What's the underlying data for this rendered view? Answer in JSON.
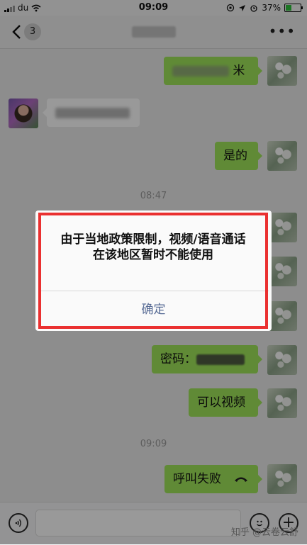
{
  "status_bar": {
    "carrier": "du",
    "time": "09:09",
    "battery_percent": "37%"
  },
  "navbar": {
    "unread_count": "3"
  },
  "messages": {
    "m1_suffix": "米",
    "m3_text": "是的",
    "time_1": "08:47",
    "m7_prefix": "密码：",
    "m8_text": "可以视频",
    "time_2": "09:09",
    "m9_text": "呼叫失败"
  },
  "dialog": {
    "message_line1": "由于当地政策限制，视频/语音通话",
    "message_line2": "在该地区暂时不能使用",
    "confirm_label": "确定"
  },
  "watermark": "知乎 @云卷云舒",
  "colors": {
    "sent_bubble": "#a0e75a",
    "received_bubble": "#ffffff",
    "dialog_button": "#576b95",
    "highlight_frame": "#ea3030"
  },
  "icons": {
    "back": "chevron-left-icon",
    "more": "more-dots-icon",
    "voice": "voice-input-icon",
    "emoji": "emoji-icon",
    "plus": "plus-icon",
    "hangup": "hangup-phone-icon"
  }
}
